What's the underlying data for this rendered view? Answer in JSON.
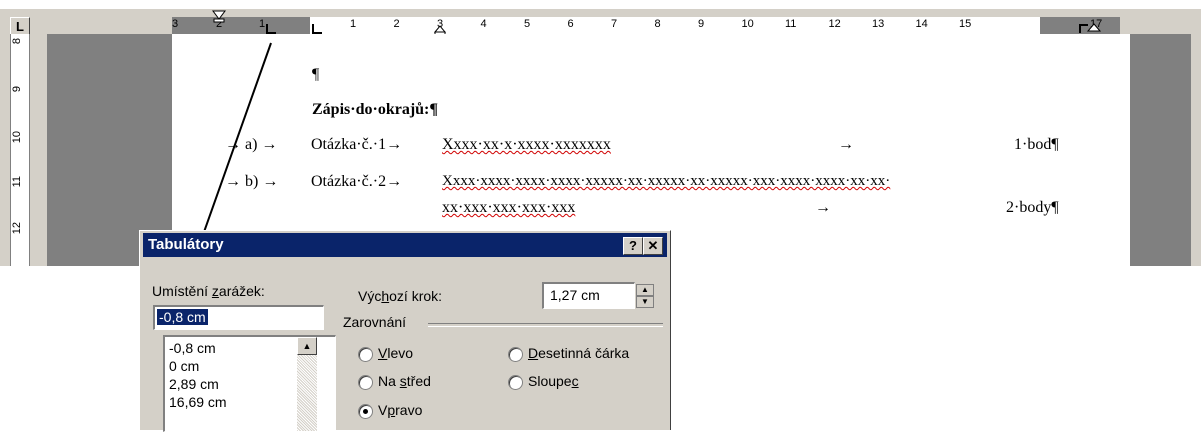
{
  "ruler": {
    "corner_glyph": "L",
    "labels_left": [
      "3",
      "2",
      "1"
    ],
    "labels_right": [
      "1",
      "2",
      "3",
      "4",
      "5",
      "6",
      "7",
      "8",
      "9",
      "10",
      "11",
      "12",
      "13",
      "14",
      "15",
      "17"
    ]
  },
  "vertical_ruler": {
    "labels": [
      "8",
      "9",
      "10",
      "11",
      "12"
    ]
  },
  "document": {
    "line1": "¶",
    "heading": "Zápis·do·okrajů:¶",
    "row_a": {
      "marker": "→ a) →",
      "question": "Otázka·č.·1→",
      "answer": "Xxxx·xx·x·xxxx·xxxxxxx",
      "arrow": "→",
      "points": "1·bod¶"
    },
    "row_b": {
      "marker": "→ b) →",
      "question": "Otázka·č.·2→",
      "answer": "Xxxx·xxxx·xxxx·xxxx·xxxxx·xx·xxxxx·xx·xxxxx·xxx·xxxx·xxxx·xx·xx·",
      "answer2": "xx·xxx·xxx·xxx·xxx",
      "arrow": "→",
      "points": "2·body¶"
    }
  },
  "dialog": {
    "title": "Tabulátory",
    "help_btn": "?",
    "close_btn": "✕",
    "tab_stop_label_pre": "Umístění ",
    "tab_stop_label_acc": "z",
    "tab_stop_label_post": "arážek:",
    "tab_stop_value": "-0,8 cm",
    "tab_stops": [
      "-0,8 cm",
      "0 cm",
      "2,89 cm",
      "16,69 cm"
    ],
    "default_step_label_pre": "Výc",
    "default_step_label_acc": "h",
    "default_step_label_post": "ozí krok:",
    "default_step_value": "1,27 cm",
    "alignment_label": "Zarovnání",
    "radios": {
      "left": {
        "pre": "",
        "acc": "V",
        "post": "levo"
      },
      "center": {
        "pre": "Na ",
        "acc": "s",
        "post": "třed"
      },
      "right": {
        "pre": "V",
        "acc": "p",
        "post": "ravo"
      },
      "decimal": {
        "pre": "",
        "acc": "D",
        "post": "esetinná čárka"
      },
      "bar": {
        "pre": "Sloupe",
        "acc": "c",
        "post": ""
      }
    }
  }
}
